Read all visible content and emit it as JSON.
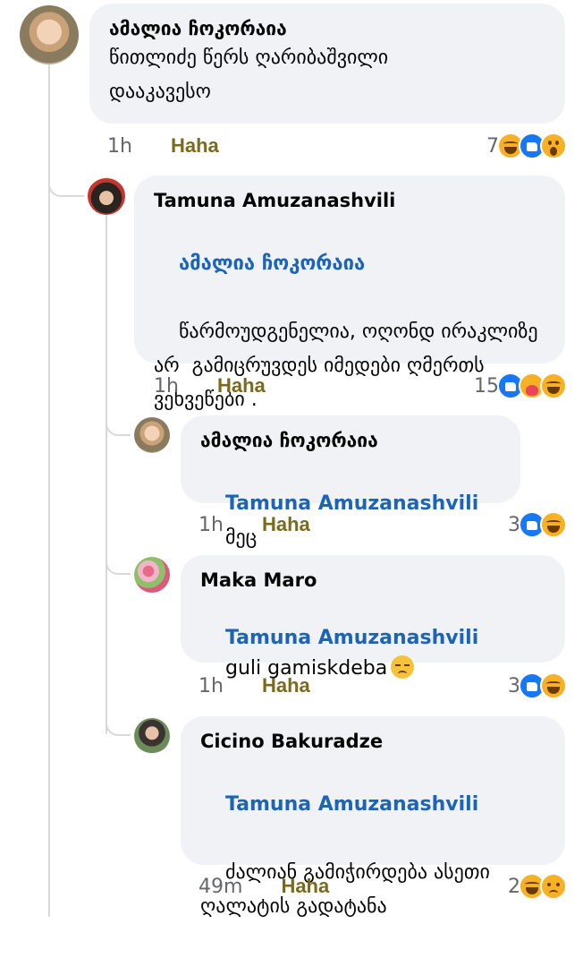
{
  "comments": [
    {
      "author": "ამალია ჩოკორაია",
      "text": "წითლიძე წერს ღარიბაშვილი დააკავესო",
      "time": "1h",
      "action": "Haha",
      "reaction_count": "7",
      "reactions": [
        "laugh",
        "like",
        "wow"
      ]
    },
    {
      "author": "Tamuna Amuzanashvili",
      "mention": "ამალია ჩოკორაია",
      "text": "წარმოუდგენელია, ოღონდ ირაკლიზე არ  გამიცრუვდეს იმედები ღმერთს ვეხვეწები .",
      "time": "1h",
      "action": "Haha",
      "reaction_count": "15",
      "reactions": [
        "like",
        "care",
        "laugh"
      ]
    },
    {
      "author": "ამალია ჩოკორაია",
      "mention": "Tamuna Amuzanashvili",
      "text": "მეც",
      "time": "1h",
      "action": "Haha",
      "reaction_count": "3",
      "reactions": [
        "like",
        "laugh"
      ]
    },
    {
      "author": "Maka Maro",
      "mention": "Tamuna Amuzanashvili",
      "text": "guli gamiskdeba",
      "emoji": "disappointed-face",
      "time": "1h",
      "action": "Haha",
      "reaction_count": "3",
      "reactions": [
        "like",
        "laugh"
      ]
    },
    {
      "author": "Cicino Bakuradze",
      "mention": "Tamuna Amuzanashvili",
      "text": "ძალიან გამიჭირდება ასეთი ღალატის გადატანა",
      "time": "49m",
      "action": "Haha",
      "reaction_count": "2",
      "reactions": [
        "laugh",
        "sad"
      ]
    }
  ],
  "colors": {
    "bubble": "#f0f2f5",
    "mention": "#1c64b8",
    "haha": "#7a6a1c",
    "muted": "#65676b",
    "like": "#1877f2"
  }
}
